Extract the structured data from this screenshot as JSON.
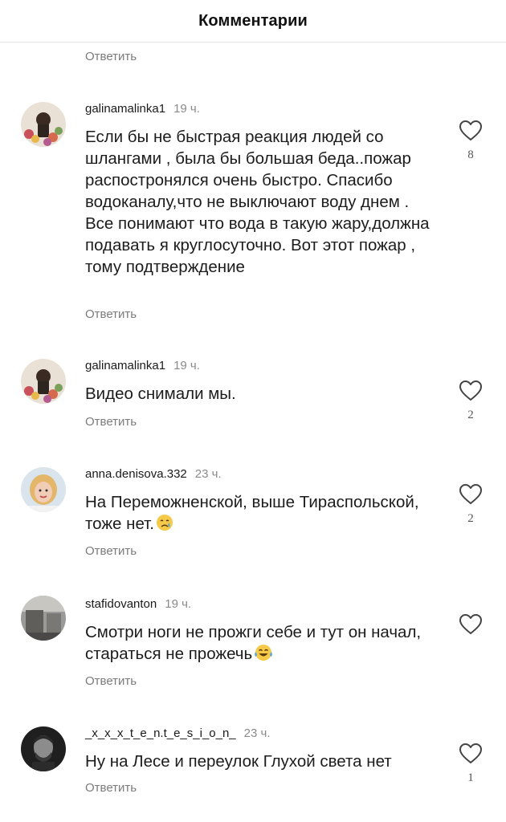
{
  "header": {
    "title": "Комментарии"
  },
  "top_reply": "Ответить",
  "comments": [
    {
      "username": "galinamalinka1",
      "time": "19 ч.",
      "text": "Если бы не быстрая реакция людей со шлангами , была бы большая беда..пожар распостронялся очень быстро. Спасибо водоканалу,что не выключают воду днем .  Все понимают что вода в такую жару,должна подавать я круглосуточно. Вот этот пожар , тому подтверждение",
      "reply": "Ответить",
      "likes": "8",
      "avatar_icon": "flowers-avatar"
    },
    {
      "username": "galinamalinka1",
      "time": "19 ч.",
      "text": "Видео снимали мы.",
      "reply": "Ответить",
      "likes": "2",
      "avatar_icon": "flowers-avatar"
    },
    {
      "username": "anna.denisova.332",
      "time": "23 ч.",
      "text": "На Переможненской, выше Тираспольской, тоже нет.",
      "emoji": "crying-face-emoji",
      "reply": "Ответить",
      "likes": "2",
      "avatar_icon": "woman-avatar"
    },
    {
      "username": "stafidovanton",
      "time": "19 ч.",
      "text": "Смотри ноги не прожги себе и тут он начал, стараться не прожечь",
      "emoji": "tears-of-joy-emoji",
      "reply": "Ответить",
      "likes": "",
      "avatar_icon": "room-avatar"
    },
    {
      "username": "_x_x_x_t_e_n.t_e_s_i_o_n_",
      "time": "23 ч.",
      "text": "Ну на Лесе и переулок Глухой света нет",
      "reply": "Ответить",
      "likes": "1",
      "avatar_icon": "man-avatar"
    }
  ],
  "colors": {
    "text": "#1c1c1c",
    "secondary": "#7b7b7b",
    "divider": "#e6e6e6"
  }
}
